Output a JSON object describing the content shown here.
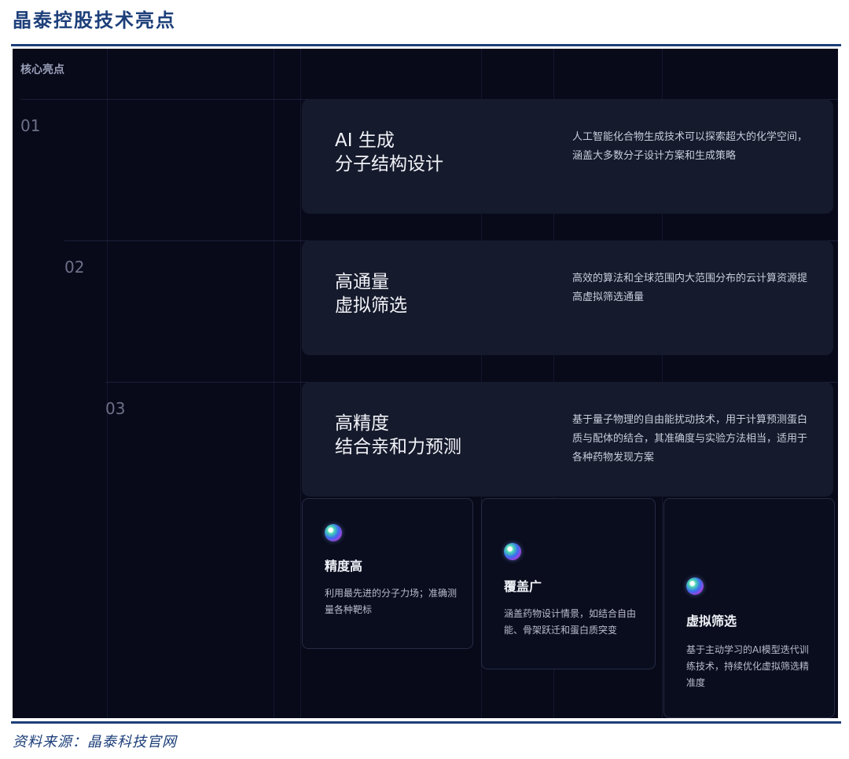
{
  "doc_title": "晶泰控股技术亮点",
  "panel": {
    "core_label": "核心亮点",
    "highlights": [
      {
        "num": "01",
        "title": "AI 生成\n分子结构设计",
        "desc": "人工智能化合物生成技术可以探索超大的化学空间，涵盖大多数分子设计方案和生成策略"
      },
      {
        "num": "02",
        "title": "高通量\n虚拟筛选",
        "desc": "高效的算法和全球范围内大范围分布的云计算资源提高虚拟筛选通量"
      },
      {
        "num": "03",
        "title": "高精度\n结合亲和力预测",
        "desc": "基于量子物理的自由能扰动技术，用于计算预测蛋白质与配体的结合，其准确度与实验方法相当，适用于各种药物发现方案"
      }
    ],
    "features": [
      {
        "title": "精度高",
        "desc": "利用最先进的分子力场；准确测量各种靶标",
        "icon": "molecule-icon"
      },
      {
        "title": "覆盖广",
        "desc": "涵盖药物设计情景，如结合自由能、骨架跃迁和蛋白质突变",
        "icon": "molecule-icon"
      },
      {
        "title": "虚拟筛选",
        "desc": "基于主动学习的AI模型迭代训练技术，持续优化虚拟筛选精准度",
        "icon": "molecule-icon"
      }
    ]
  },
  "source": "资料来源：晶泰科技官网",
  "colors": {
    "accent": "#1d3f7a",
    "panel_bg": "#080a1a",
    "card_bg": "#151a2c"
  }
}
